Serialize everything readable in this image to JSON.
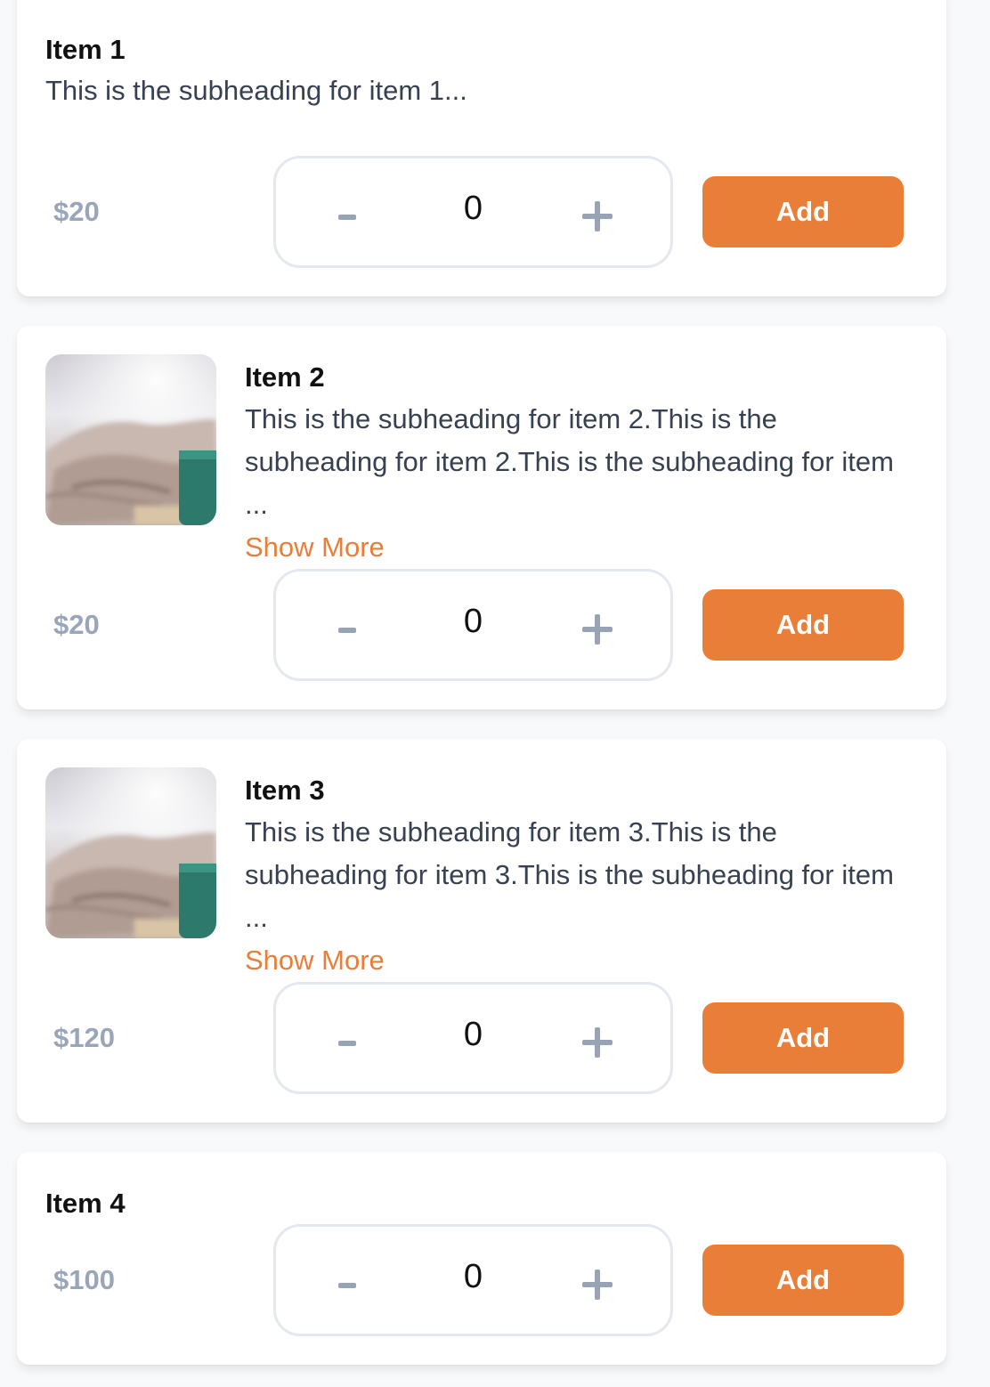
{
  "colors": {
    "accent": "#e87e37",
    "price": "#99a5b8",
    "stepper_border": "#e4e8ef",
    "card_bg": "#ffffff"
  },
  "items": [
    {
      "title": "Item 1",
      "subtitle": "This is the subheading for item 1...",
      "show_more": "",
      "price": "$20",
      "quantity": "0",
      "minus_label": "-",
      "plus_label": "+",
      "add_label": "Add",
      "image": "none"
    },
    {
      "title": "Item 2",
      "subtitle": "This is the subheading for item 2.This is the subheading for item 2.This is the subheading for item ...",
      "show_more": "Show More",
      "price": "$20",
      "quantity": "0",
      "minus_label": "-",
      "plus_label": "+",
      "add_label": "Add",
      "image": "blanket-and-mug-photo"
    },
    {
      "title": "Item 3",
      "subtitle": "This is the subheading for item 3.This is the subheading for item 3.This is the subheading for item ...",
      "show_more": "Show More",
      "price": "$120",
      "quantity": "0",
      "minus_label": "-",
      "plus_label": "+",
      "add_label": "Add",
      "image": "blanket-and-mug-photo"
    },
    {
      "title": "Item 4",
      "subtitle": "",
      "show_more": "",
      "price": "$100",
      "quantity": "0",
      "minus_label": "-",
      "plus_label": "+",
      "add_label": "Add",
      "image": "none"
    }
  ]
}
